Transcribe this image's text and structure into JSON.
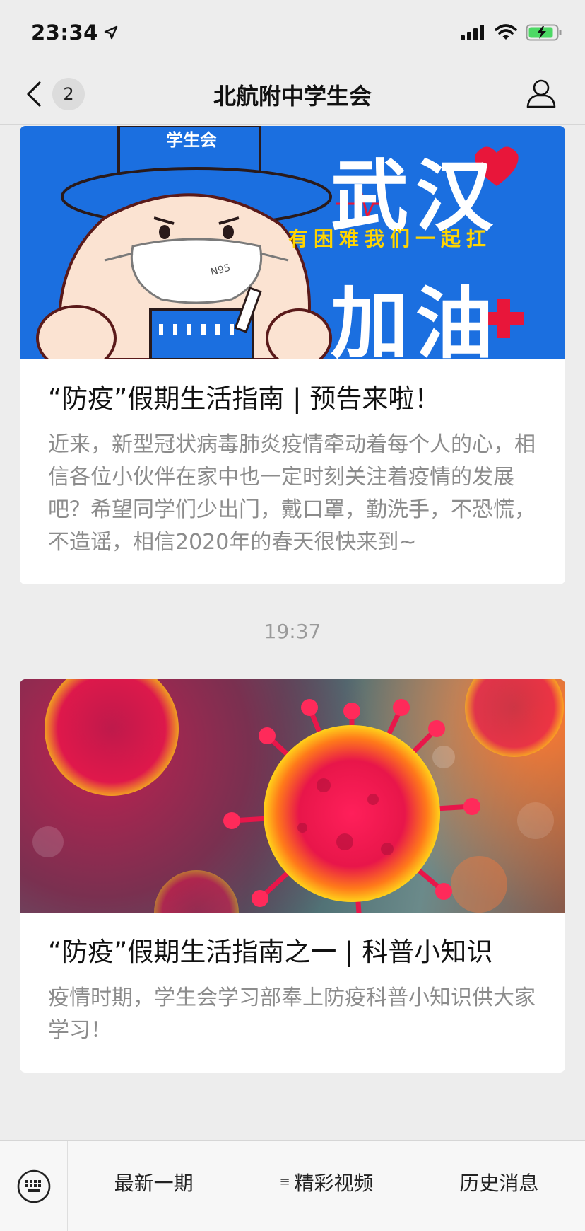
{
  "status_bar": {
    "time": "23:34",
    "icons": [
      "location-arrow-icon",
      "signal-icon",
      "wifi-icon",
      "battery-charging-icon"
    ],
    "battery_color": "#4cd964"
  },
  "nav": {
    "unread_count": "2",
    "title": "北航附中学生会",
    "back_icon": "chevron-left-icon",
    "profile_icon": "user-icon"
  },
  "articles": [
    {
      "banner": {
        "background": "#1b6fe0",
        "hat_text": "学生会",
        "mask_text": "N95",
        "big_text_1": "武汉",
        "slogan": "有困难我们一起扛",
        "big_text_2": "加油"
      },
      "title": "“防疫”假期生活指南 | 预告来啦！",
      "description": "近来，新型冠状病毒肺炎疫情牵动着每个人的心，相信各位小伙伴在家中也一定时刻关注着疫情的发展吧？希望同学们少出门，戴口罩，勤洗手，不恐慌，不造谣，相信2020年的春天很快来到~"
    },
    {
      "timestamp": "19:37",
      "banner": {
        "background": "#4a6a7a",
        "virus_color": "#e8164a"
      },
      "title": "“防疫”假期生活指南之一 | 科普小知识",
      "description": "疫情时期，学生会学习部奉上防疫科普小知识供大家学习！"
    }
  ],
  "bottom_menu": {
    "keyboard_icon": "keyboard-icon",
    "items": [
      {
        "label": "最新一期",
        "has_submenu": false
      },
      {
        "label": "精彩视频",
        "has_submenu": true,
        "icon": "menu-lines-icon"
      },
      {
        "label": "历史消息",
        "has_submenu": false
      }
    ]
  }
}
